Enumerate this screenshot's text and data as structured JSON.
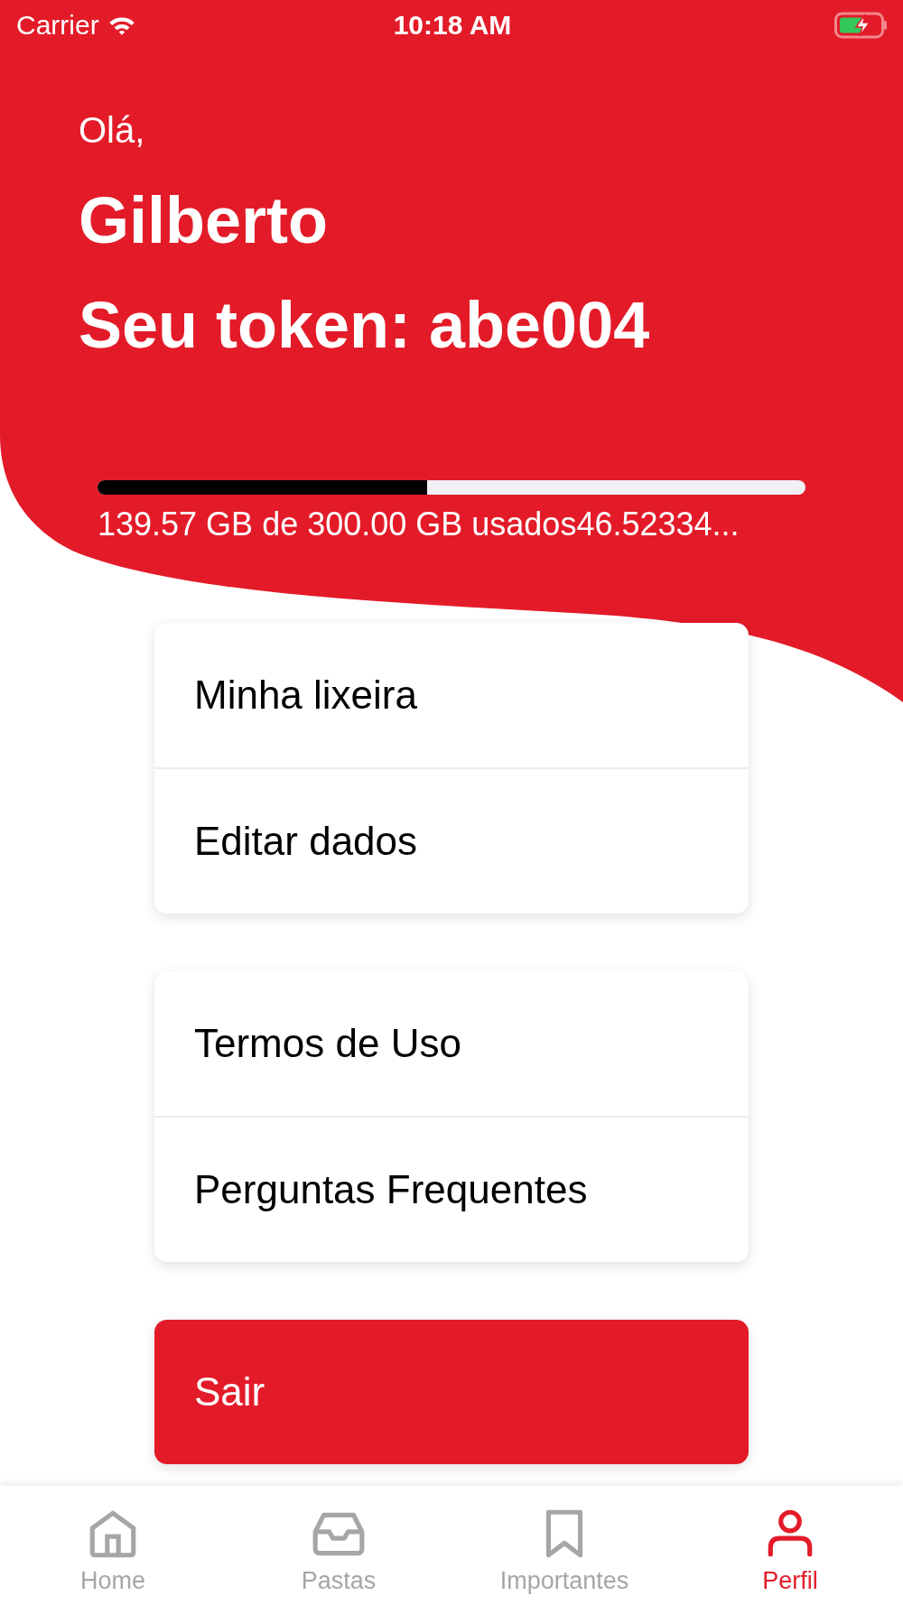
{
  "status_bar": {
    "carrier": "Carrier",
    "time": "10:18 AM",
    "battery_charging": true
  },
  "greeting": "Olá,",
  "name": "Gilberto",
  "token": "Seu token: abe004",
  "storage": {
    "level": 0.465,
    "reading": "139.57 GB de 300.00 GB usados46.52334..."
  },
  "menu_groups": [
    {
      "items": [
        "Minha lixeira",
        "Editar dados"
      ]
    },
    {
      "items": [
        "Termos de Uso",
        "Perguntas Frequentes"
      ]
    }
  ],
  "logout_button": "Sair",
  "tabs": [
    {
      "label": "Home",
      "kind": "home",
      "selected": false
    },
    {
      "label": "Pastas",
      "kind": "tray",
      "selected": false
    },
    {
      "label": "Importantes",
      "kind": "bookmark",
      "selected": false
    },
    {
      "label": "Perfil",
      "kind": "profile",
      "selected": true
    }
  ]
}
